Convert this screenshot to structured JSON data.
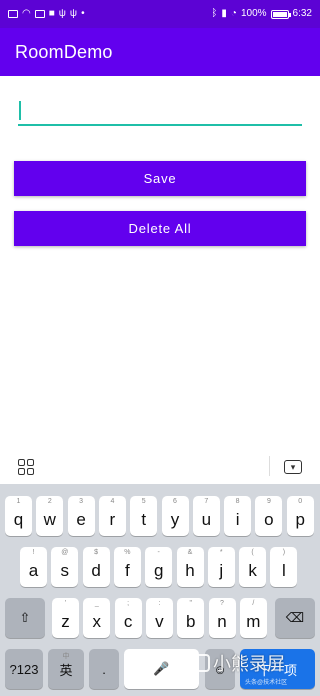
{
  "status_bar": {
    "battery_percent": 100,
    "battery_label": "100%",
    "time": "6:32"
  },
  "app_bar": {
    "title": "RoomDemo"
  },
  "input": {
    "value": "",
    "placeholder": ""
  },
  "buttons": {
    "save": "Save",
    "delete_all": "Delete All"
  },
  "keyboard": {
    "row1": [
      {
        "k": "q",
        "s": "1"
      },
      {
        "k": "w",
        "s": "2"
      },
      {
        "k": "e",
        "s": "3"
      },
      {
        "k": "r",
        "s": "4"
      },
      {
        "k": "t",
        "s": "5"
      },
      {
        "k": "y",
        "s": "6"
      },
      {
        "k": "u",
        "s": "7"
      },
      {
        "k": "i",
        "s": "8"
      },
      {
        "k": "o",
        "s": "9"
      },
      {
        "k": "p",
        "s": "0"
      }
    ],
    "row2": [
      {
        "k": "a",
        "s": "!"
      },
      {
        "k": "s",
        "s": "@"
      },
      {
        "k": "d",
        "s": "$"
      },
      {
        "k": "f",
        "s": "%"
      },
      {
        "k": "g",
        "s": "-"
      },
      {
        "k": "h",
        "s": "&"
      },
      {
        "k": "j",
        "s": "*"
      },
      {
        "k": "k",
        "s": "("
      },
      {
        "k": "l",
        "s": ")"
      }
    ],
    "row3": [
      {
        "k": "z",
        "s": "'"
      },
      {
        "k": "x",
        "s": "_"
      },
      {
        "k": "c",
        "s": ";"
      },
      {
        "k": "v",
        "s": ":"
      },
      {
        "k": "b",
        "s": "\""
      },
      {
        "k": "n",
        "s": "?"
      },
      {
        "k": "m",
        "s": "/"
      }
    ],
    "bottom": {
      "symbols": "?123",
      "lang": "英",
      "lang_sub": "中",
      "period": ".",
      "enter": "下一项"
    }
  },
  "watermark": {
    "text": "小熊录屏",
    "sub": "头条@技术社区"
  }
}
